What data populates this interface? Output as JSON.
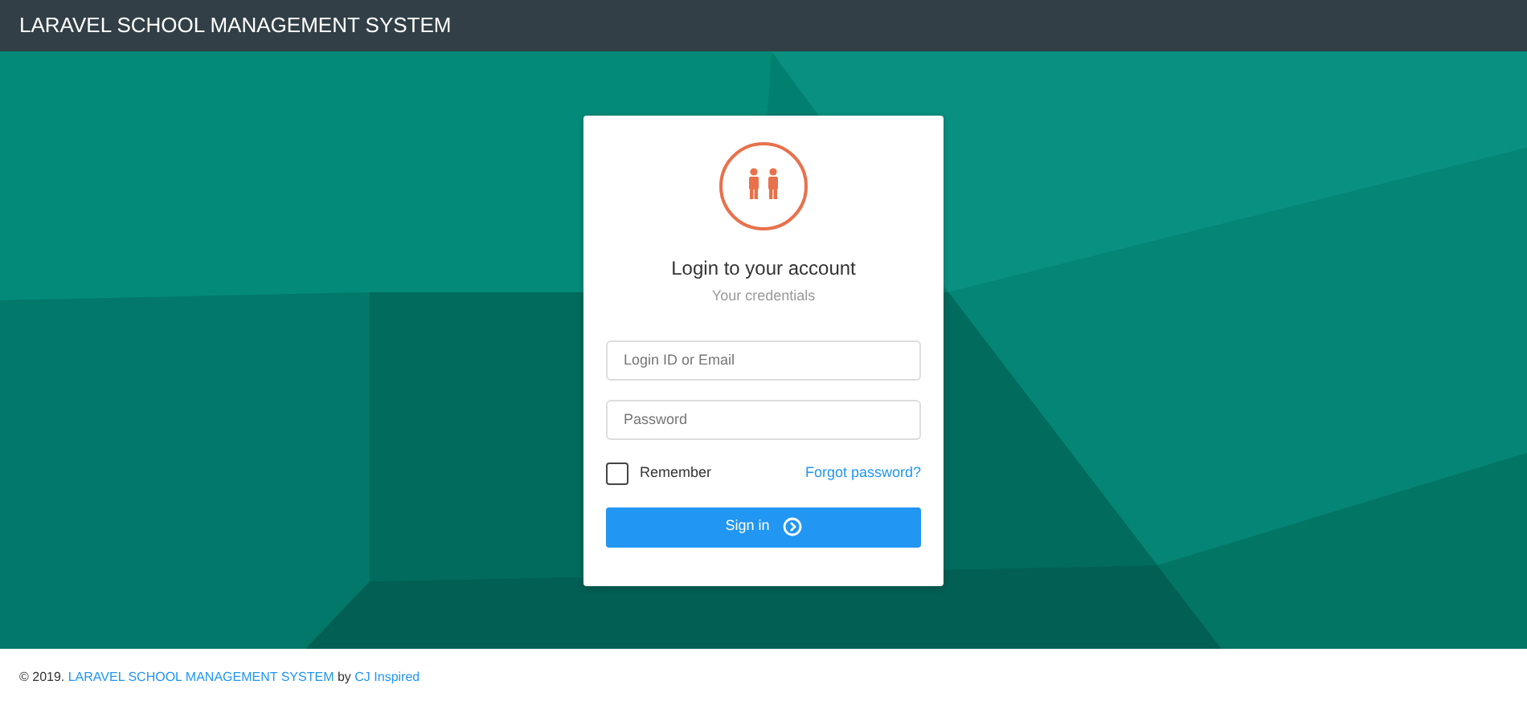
{
  "navbar": {
    "title": "LARAVEL SCHOOL MANAGEMENT SYSTEM"
  },
  "login": {
    "heading": "Login to your account",
    "subheading": "Your credentials",
    "login_field": {
      "placeholder": "Login ID or Email"
    },
    "password_field": {
      "placeholder": "Password"
    },
    "remember": {
      "label": "Remember",
      "checked": false
    },
    "forgot_link": "Forgot password?",
    "submit": "Sign in"
  },
  "footer": {
    "prefix": "© 2019.",
    "app_link": "LARAVEL SCHOOL MANAGEMENT SYSTEM",
    "by": "by",
    "author_link": "CJ Inspired"
  }
}
